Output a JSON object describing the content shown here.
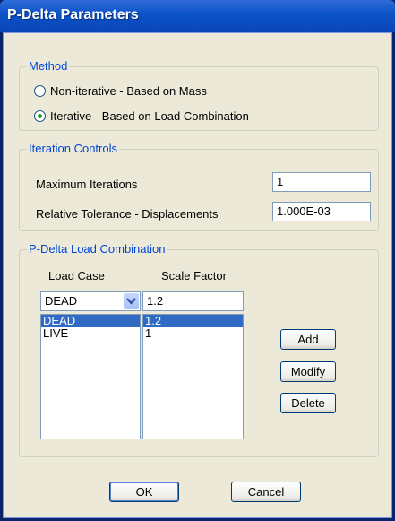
{
  "window": {
    "title": "P-Delta Parameters"
  },
  "method": {
    "legend": "Method",
    "option1": "Non-iterative - Based on Mass",
    "option2": "Iterative - Based on Load Combination",
    "selected": "option2"
  },
  "iteration": {
    "legend": "Iteration Controls",
    "max_label": "Maximum Iterations",
    "max_value": "1",
    "tol_label": "Relative Tolerance - Displacements",
    "tol_value": "1.000E-03"
  },
  "combo": {
    "legend": "P-Delta Load Combination",
    "col_case": "Load Case",
    "col_scale": "Scale Factor",
    "case_value": "DEAD",
    "scale_value": "1.2",
    "rows": [
      {
        "case": "DEAD",
        "scale": "1.2",
        "selected": true
      },
      {
        "case": "LIVE",
        "scale": "1",
        "selected": false
      }
    ],
    "add_label": "Add",
    "modify_label": "Modify",
    "delete_label": "Delete"
  },
  "buttons": {
    "ok": "OK",
    "cancel": "Cancel"
  },
  "colors": {
    "accent": "#0046d5",
    "selection": "#316ac5",
    "titlebar": "#0a52c7"
  },
  "icons": {
    "dropdown": "chevron-down-icon"
  }
}
